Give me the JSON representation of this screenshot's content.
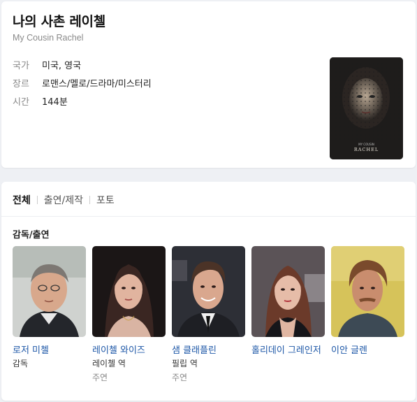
{
  "movie": {
    "title": "나의 사촌 레이첼",
    "original_title": "My Cousin Rachel",
    "info": [
      {
        "label": "국가",
        "value": "미국, 영국"
      },
      {
        "label": "장르",
        "value": "로맨스/멜로/드라마/미스터리"
      },
      {
        "label": "시간",
        "value": "144분"
      }
    ],
    "poster": {
      "small_text": "MY COUSIN",
      "title": "RACHEL"
    }
  },
  "tabs": [
    "전체",
    "출연/제작",
    "포토"
  ],
  "section_title": "감독/출연",
  "people": [
    {
      "name": "로저 미첼",
      "role": "감독",
      "type": ""
    },
    {
      "name": "레이첼 와이즈",
      "role": "레이첼 역",
      "type": "주연"
    },
    {
      "name": "샘 클래플린",
      "role": "필립 역",
      "type": "주연"
    },
    {
      "name": "홀리데이 그레인저",
      "role": "",
      "type": ""
    },
    {
      "name": "이안 글렌",
      "role": "",
      "type": ""
    }
  ],
  "colors": {
    "link": "#1d57a7",
    "label": "#888888",
    "background": "#eef0f4"
  }
}
